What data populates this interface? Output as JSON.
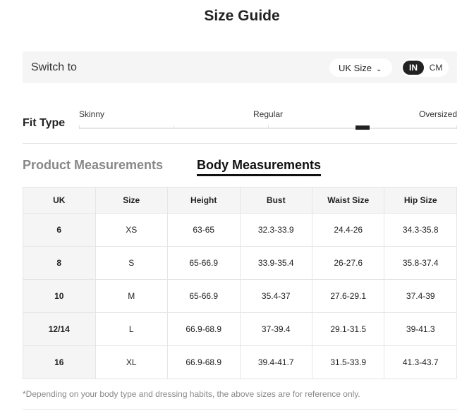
{
  "title": "Size Guide",
  "switch": {
    "label": "Switch to",
    "size_system": "UK Size",
    "units": [
      "IN",
      "CM"
    ],
    "selected_unit": "IN"
  },
  "fit": {
    "label": "Fit Type",
    "options": [
      "Skinny",
      "Regular",
      "Oversized"
    ],
    "position_fraction": 0.75
  },
  "tabs": [
    "Product Measurements",
    "Body Measurements"
  ],
  "active_tab": "Body Measurements",
  "table": {
    "headers": [
      "UK",
      "Size",
      "Height",
      "Bust",
      "Waist Size",
      "Hip Size"
    ],
    "rows": [
      [
        "6",
        "XS",
        "63-65",
        "32.3-33.9",
        "24.4-26",
        "34.3-35.8"
      ],
      [
        "8",
        "S",
        "65-66.9",
        "33.9-35.4",
        "26-27.6",
        "35.8-37.4"
      ],
      [
        "10",
        "M",
        "65-66.9",
        "35.4-37",
        "27.6-29.1",
        "37.4-39"
      ],
      [
        "12/14",
        "L",
        "66.9-68.9",
        "37-39.4",
        "29.1-31.5",
        "39-41.3"
      ],
      [
        "16",
        "XL",
        "66.9-68.9",
        "39.4-41.7",
        "31.5-33.9",
        "41.3-43.7"
      ]
    ]
  },
  "note": "*Depending on your body type and dressing habits, the above sizes are for reference only."
}
